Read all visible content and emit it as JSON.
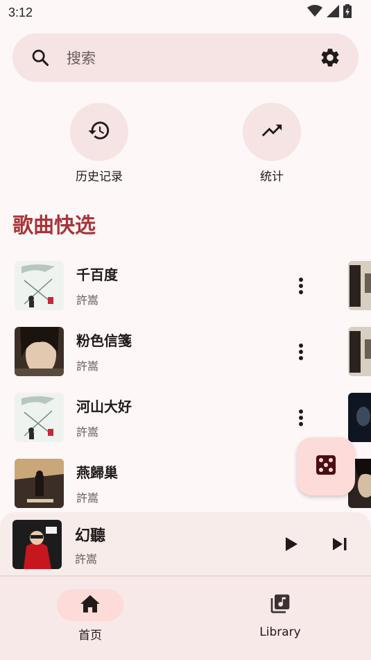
{
  "status_bar": {
    "time": "3:12"
  },
  "search": {
    "placeholder": "搜索"
  },
  "quick_actions": [
    {
      "label": "历史记录",
      "icon": "history-icon"
    },
    {
      "label": "统计",
      "icon": "trending-up-icon"
    }
  ],
  "section": {
    "title": "歌曲快选"
  },
  "songs": [
    {
      "title": "千百度",
      "artist": "許嵩"
    },
    {
      "title": "粉色信箋",
      "artist": "許嵩"
    },
    {
      "title": "河山大好",
      "artist": "許嵩"
    },
    {
      "title": "燕歸巢",
      "artist": "許嵩"
    }
  ],
  "now_playing": {
    "title": "幻聽",
    "artist": "許嵩"
  },
  "bottom_nav": [
    {
      "label": "首页",
      "icon": "home-icon",
      "active": true
    },
    {
      "label": "Library",
      "icon": "library-music-icon",
      "active": false
    }
  ],
  "colors": {
    "accent": "#a8353a",
    "surface": "#f5e4e3",
    "fab": "#fddbd8",
    "background": "#fdf7f7"
  }
}
